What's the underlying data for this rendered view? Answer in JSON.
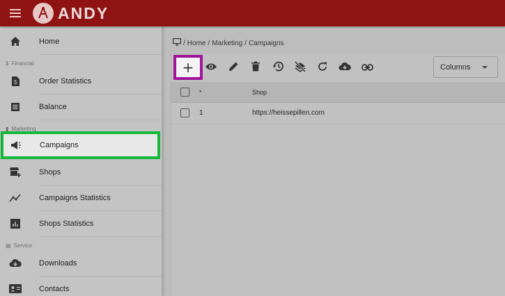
{
  "header": {
    "brand": "ANDY"
  },
  "sidebar": {
    "home": "Home",
    "section_financial": "Financial",
    "order_statistics": "Order Statistics",
    "balance": "Balance",
    "section_marketing": "Marketing",
    "campaigns": "Campaigns",
    "shops": "Shops",
    "campaigns_statistics": "Campaigns Statistics",
    "shops_statistics": "Shops Statistics",
    "section_service": "Service",
    "downloads": "Downloads",
    "contacts": "Contacts"
  },
  "breadcrumb": {
    "sep1": "/",
    "home": "Home",
    "sep2": "/",
    "marketing": "Marketing",
    "sep3": "/",
    "current": "Campaigns"
  },
  "toolbar": {
    "add_label": "+",
    "columns_label": "Columns"
  },
  "table": {
    "headers": {
      "id": "*",
      "shop": "Shop"
    },
    "rows": [
      {
        "id": "1",
        "shop": "https://heissepillen.com"
      }
    ]
  },
  "colors": {
    "header": "#8f1313",
    "active_highlight": "#15b83a",
    "add_highlight": "#a0149a"
  }
}
